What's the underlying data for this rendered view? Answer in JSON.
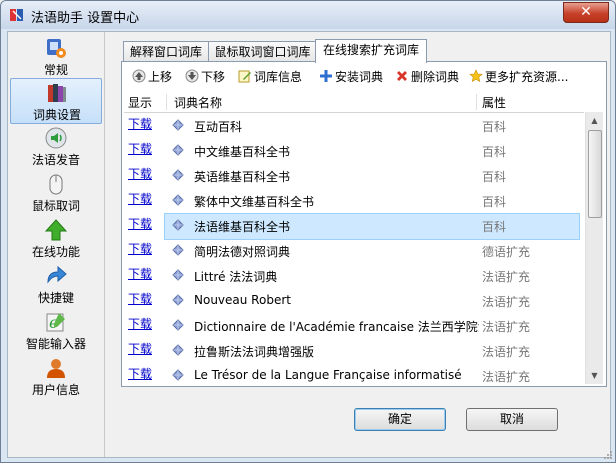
{
  "window": {
    "title": "法语助手 设置中心",
    "close_label": "✕"
  },
  "sidebar": {
    "items": [
      {
        "label": "常规",
        "icon": "general-settings-icon"
      },
      {
        "label": "词典设置",
        "icon": "dictionary-books-icon",
        "selected": true
      },
      {
        "label": "法语发音",
        "icon": "speaker-icon"
      },
      {
        "label": "鼠标取词",
        "icon": "mouse-icon"
      },
      {
        "label": "在线功能",
        "icon": "up-arrow-icon"
      },
      {
        "label": "快捷键",
        "icon": "shortcut-arrow-icon"
      },
      {
        "label": "智能输入器",
        "icon": "smart-input-icon"
      },
      {
        "label": "用户信息",
        "icon": "user-icon"
      }
    ]
  },
  "tabs": [
    {
      "label": "解释窗口词库"
    },
    {
      "label": "鼠标取词窗口词库"
    },
    {
      "label": "在线搜索扩充词库",
      "active": true
    }
  ],
  "toolbar": {
    "move_up": "上移",
    "move_down": "下移",
    "dict_info": "词库信息",
    "install": "安装词典",
    "delete": "删除词典",
    "more": "更多扩充资源..."
  },
  "list": {
    "columns": {
      "show": "显示",
      "name": "词典名称",
      "attr": "属性"
    },
    "rows": [
      {
        "action": "下载",
        "name": "互动百科",
        "attr": "百科"
      },
      {
        "action": "下载",
        "name": "中文维基百科全书",
        "attr": "百科"
      },
      {
        "action": "下载",
        "name": "英语维基百科全书",
        "attr": "百科"
      },
      {
        "action": "下载",
        "name": "繁体中文维基百科全书",
        "attr": "百科"
      },
      {
        "action": "下载",
        "name": "法语维基百科全书",
        "attr": "百科",
        "selected": true
      },
      {
        "action": "下载",
        "name": "简明法德对照词典",
        "attr": "德语扩充"
      },
      {
        "action": "下载",
        "name": "Littré 法法词典",
        "attr": "法语扩充"
      },
      {
        "action": "下载",
        "name": "Nouveau Robert",
        "attr": "法语扩充"
      },
      {
        "action": "下载",
        "name": "Dictionnaire de l'Académie francaise 法兰西学院法法词典",
        "attr": "法语扩充"
      },
      {
        "action": "下载",
        "name": "拉鲁斯法法词典增强版",
        "attr": "法语扩充"
      },
      {
        "action": "下载",
        "name": "Le Trésor de la Langue Française informatisé",
        "attr": "法语扩充"
      }
    ]
  },
  "buttons": {
    "ok": "确定",
    "cancel": "取消"
  },
  "colors": {
    "link": "#0000cc",
    "selection": "#cde8ff",
    "close": "#c7412a"
  }
}
